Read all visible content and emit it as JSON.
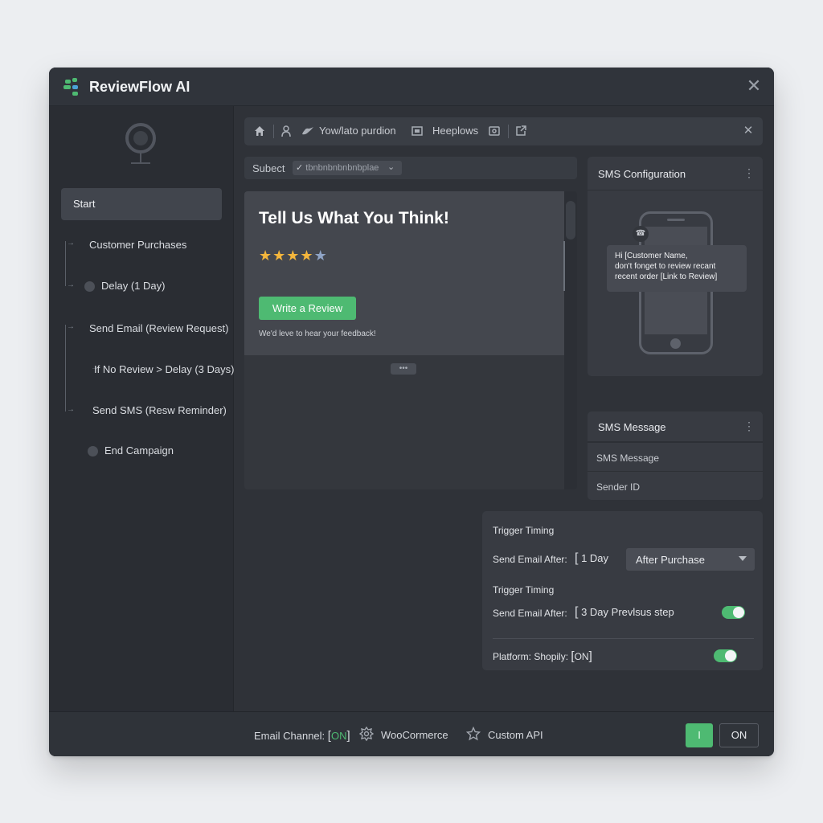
{
  "app": {
    "title": "ReviewFlow AI",
    "accent_color": "#4eba72",
    "close_icon": "close-icon"
  },
  "sidebar": {
    "start_label": "Start",
    "items": [
      {
        "label": "Customer Purchases"
      },
      {
        "label": "Delay (1 Day)"
      },
      {
        "label": "Send Email (Review Request)"
      },
      {
        "label": "If No Review > Delay (3 Days)"
      },
      {
        "label": "Send SMS (Resw Reminder)"
      },
      {
        "label": "End Campaign"
      }
    ]
  },
  "toolbar": {
    "item_1": "Yow/lato purdion",
    "item_2": "Heeplows"
  },
  "subject": {
    "label": "Subect",
    "value": "tbnbnbnbnbnbplae"
  },
  "preview": {
    "title": "Tell Us What You Think!",
    "rating": 4,
    "rating_max": 5,
    "button_label": "Write a Review",
    "note": "We'd leve to hear your feedback!",
    "more_indicator": "•••"
  },
  "sms_config": {
    "title": "SMS Configuration",
    "bubble_line_1": "Hi [Customer Name,",
    "bubble_line_2": "don't fonget to review recant",
    "bubble_line_3": "recent order [Link to Review]"
  },
  "sms_message": {
    "title": "SMS Message",
    "rows": [
      "SMS Message",
      "Sender ID"
    ]
  },
  "trigger": {
    "title_1": "Trigger Timing",
    "send_label_1": "Send Email After:",
    "value_1": "1 Day",
    "select_value": "After Purchase",
    "title_2": "Trigger Timing",
    "send_label_2": "Send Email After:",
    "value_2": "3 Day Prevlsus step",
    "toggle_1_on": true,
    "platform_label": "Platform: Shopily:",
    "platform_value": "ON",
    "toggle_2_on": true
  },
  "footer": {
    "email_channel_label": "Email Channel:",
    "email_channel_value": "ON",
    "woocommerce_label": "WooCormerce",
    "custom_api_label": "Custom API",
    "green_button_label": "I",
    "on_button_label": "ON"
  }
}
